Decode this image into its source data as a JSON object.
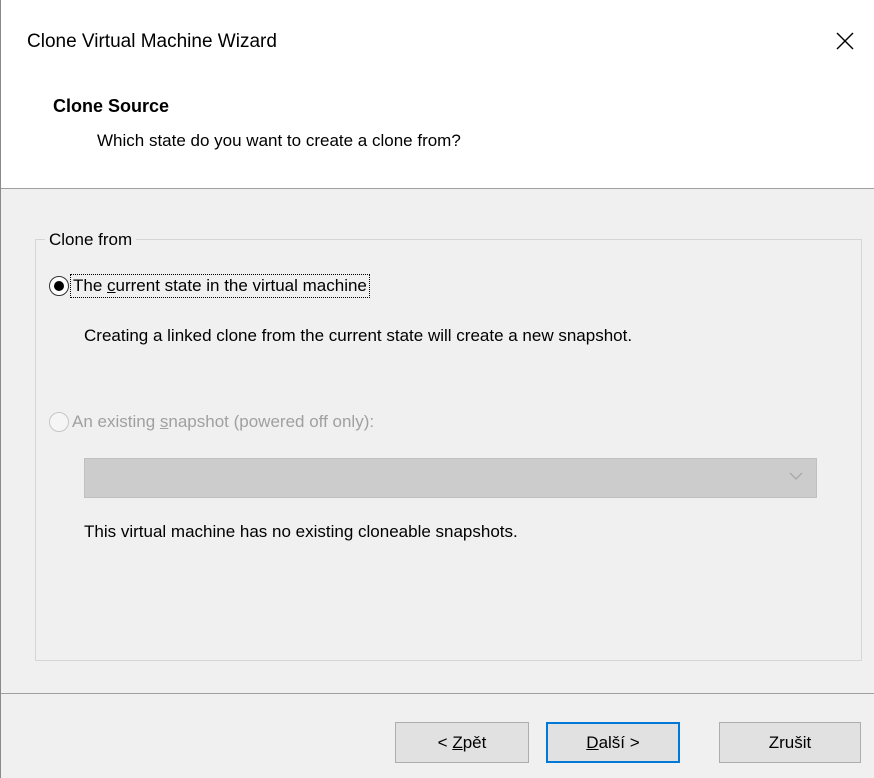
{
  "window": {
    "title": "Clone Virtual Machine Wizard",
    "close_glyph": "✕"
  },
  "header": {
    "title": "Clone Source",
    "subtitle": "Which state do you want to create a clone from?"
  },
  "clone_from": {
    "group_label": "Clone from",
    "options": [
      {
        "pre": "The ",
        "access_key": "c",
        "post": "urrent state in the virtual machine",
        "selected": true,
        "enabled": true,
        "description": "Creating a linked clone from the current state will create a new snapshot."
      },
      {
        "pre": "An existing ",
        "access_key": "s",
        "post": "napshot (powered off only):",
        "selected": false,
        "enabled": false,
        "description": "This virtual machine has no existing cloneable snapshots."
      }
    ],
    "snapshot_select_value": ""
  },
  "buttons": {
    "back": {
      "pre": "< ",
      "access_key": "Z",
      "post": "pět"
    },
    "next": {
      "pre": "",
      "access_key": "D",
      "post": "alší >"
    },
    "cancel": {
      "label": "Zrušit"
    }
  },
  "colors": {
    "default_button_border": "#0078d7",
    "disabled_text": "#a0a0a0"
  }
}
